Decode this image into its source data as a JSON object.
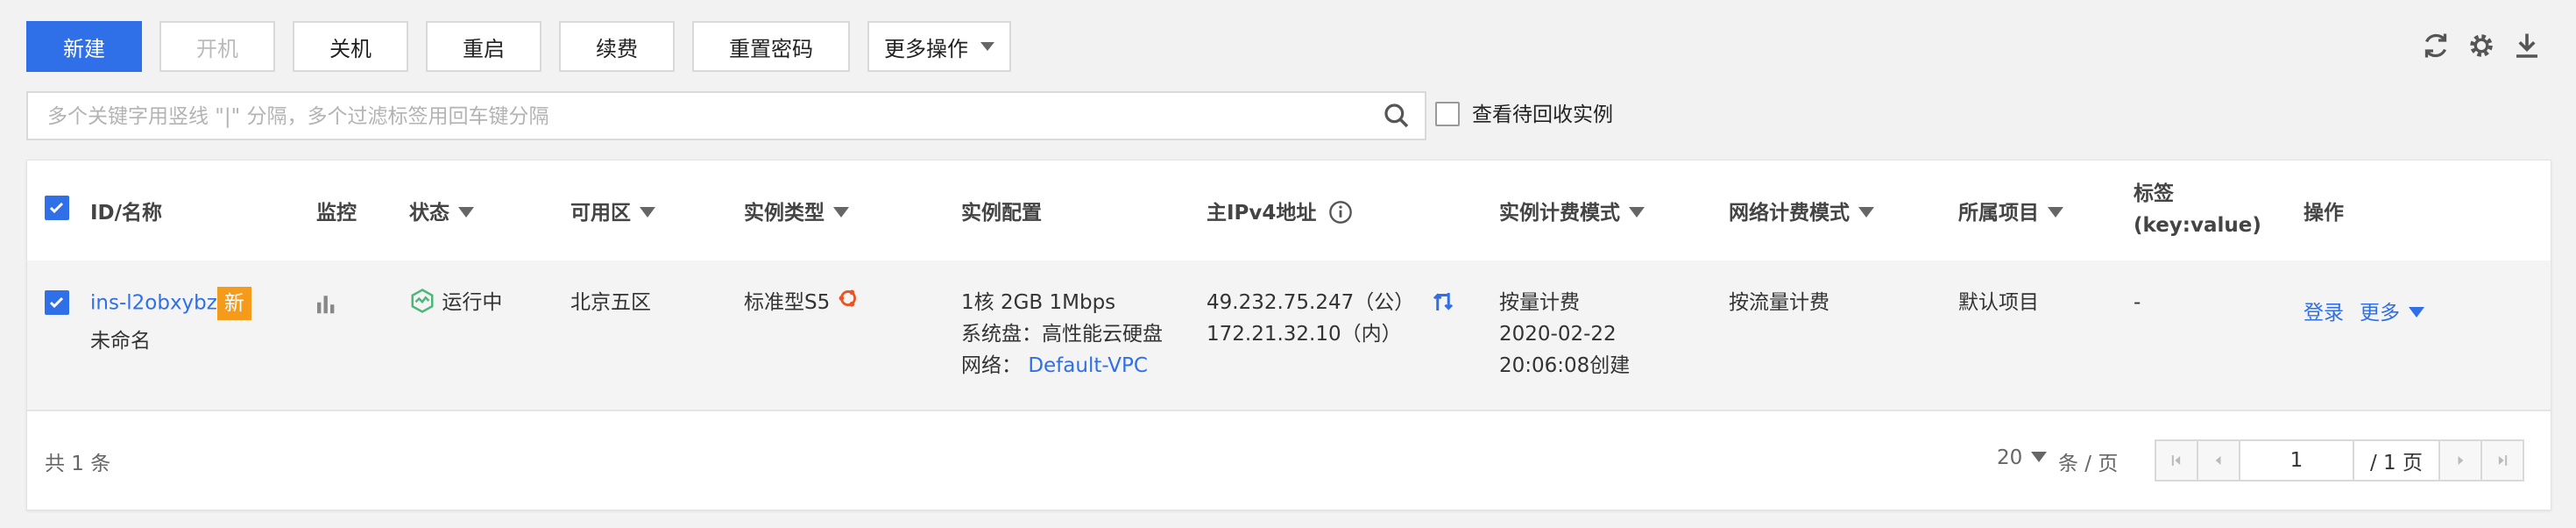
{
  "toolbar": {
    "create": "新建",
    "power_on": "开机",
    "power_off": "关机",
    "restart": "重启",
    "renew": "续费",
    "reset_password": "重置密码",
    "more_actions": "更多操作"
  },
  "icons": {
    "refresh": "refresh-icon",
    "settings": "gear-icon",
    "download": "download-icon",
    "search": "search-icon"
  },
  "search": {
    "placeholder": "多个关键字用竖线 \"|\" 分隔，多个过滤标签用回车键分隔",
    "value": ""
  },
  "recycle_checkbox_label": "查看待回收实例",
  "table": {
    "headers": {
      "id_name": "ID/名称",
      "monitor": "监控",
      "status": "状态",
      "zone": "可用区",
      "instance_type": "实例类型",
      "config": "实例配置",
      "ipv4": "主IPv4地址",
      "billing_mode": "实例计费模式",
      "network_billing": "网络计费模式",
      "project": "所属项目",
      "tag_line1": "标签",
      "tag_line2": "(key:value)",
      "actions": "操作"
    },
    "rows": [
      {
        "id": "ins-l2obxybz",
        "new_badge": "新",
        "name": "未命名",
        "status": "运行中",
        "zone": "北京五区",
        "instance_type": "标准型S5",
        "config_line1": "1核 2GB 1Mbps",
        "config_line2": "系统盘：高性能云硬盘",
        "config_network_label": "网络：",
        "config_network_value": "Default-VPC",
        "ip_public": "49.232.75.247（公）",
        "ip_private": "172.21.32.10（内）",
        "billing_line1": "按量计费",
        "billing_line2": "2020-02-22",
        "billing_line3": "20:06:08创建",
        "network_billing": "按流量计费",
        "project": "默认项目",
        "tags": "-",
        "action_login": "登录",
        "action_more": "更多"
      }
    ]
  },
  "footer": {
    "total": "共 1 条",
    "page_size": "20",
    "per_page_label": "条 / 页",
    "current_page": "1",
    "total_pages": "/ 1 页"
  },
  "colors": {
    "primary": "#2f6fe8",
    "badge": "#f59b1b",
    "running": "#4cb878"
  }
}
